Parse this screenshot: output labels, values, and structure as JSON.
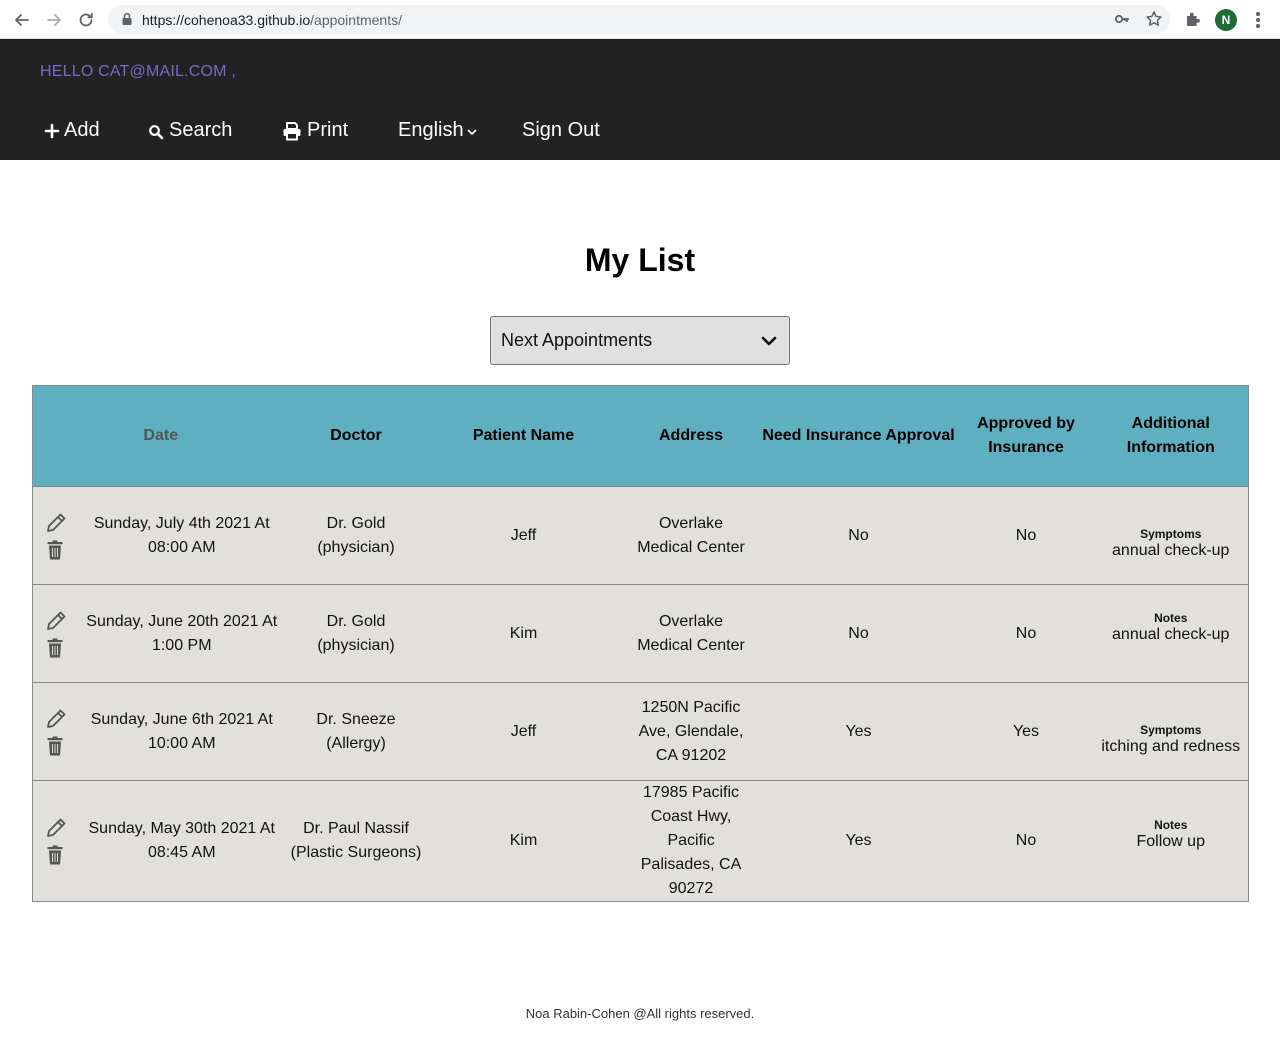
{
  "browser": {
    "url_host": "https://cohenoa33.github.io",
    "url_path": "/appointments/",
    "profile_initial": "N"
  },
  "header": {
    "greeting": "HELLO CAT@MAIL.COM ,",
    "menu": {
      "add": "Add",
      "search": "Search",
      "print": "Print",
      "language": "English",
      "sign_out": "Sign Out"
    }
  },
  "main": {
    "title": "My List",
    "filter_selected": "Next Appointments",
    "table": {
      "headers": {
        "date": "Date",
        "doctor": "Doctor",
        "patient": "Patient Name",
        "address": "Address",
        "need_insurance": "Need Insurance Approval",
        "approved": "Approved by Insurance",
        "info": "Additional Information"
      },
      "rows": [
        {
          "date": "Sunday, July 4th 2021 At 08:00 AM",
          "doctor": "Dr. Gold (physician)",
          "patient": "Jeff",
          "address": "Overlake Medical Center",
          "need_insurance": "No",
          "approved": "No",
          "info_label": "Symptoms",
          "info_text": "annual check-up"
        },
        {
          "date": "Sunday, June 20th 2021 At 1:00 PM",
          "doctor": "Dr. Gold (physician)",
          "patient": "Kim",
          "address": "Overlake Medical Center",
          "need_insurance": "No",
          "approved": "No",
          "info_label": "Notes",
          "info_text": "annual check-up"
        },
        {
          "date": "Sunday, June 6th 2021 At 10:00 AM",
          "doctor": "Dr. Sneeze (Allergy)",
          "patient": "Jeff",
          "address": "1250N Pacific Ave, Glendale, CA 91202",
          "need_insurance": "Yes",
          "approved": "Yes",
          "info_label": "Symptoms",
          "info_text": "itching and redness"
        },
        {
          "date": "Sunday, May 30th 2021 At 08:45 AM",
          "doctor": "Dr. Paul Nassif (Plastic Surgeons)",
          "patient": "Kim",
          "address": "17985 Pacific Coast Hwy, Pacific Palisades, CA 90272",
          "need_insurance": "Yes",
          "approved": "No",
          "info_label": "Notes",
          "info_text": "Follow up"
        }
      ]
    }
  },
  "footer": {
    "text": "Noa Rabin-Cohen @All rights reserved."
  },
  "colors": {
    "header_bg": "#222222",
    "greeting": "#7b68c9",
    "table_header_bg": "#5eafc0",
    "table_row_bg": "#e2e0dc"
  }
}
